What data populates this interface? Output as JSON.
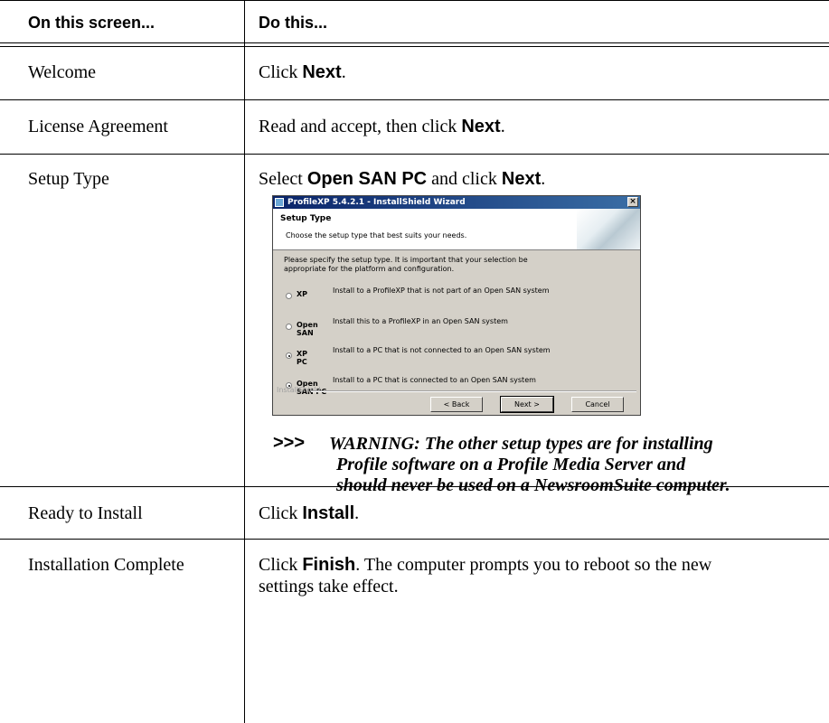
{
  "table": {
    "headers": [
      "On this screen...",
      "Do this..."
    ],
    "rows": [
      {
        "screen": "Welcome",
        "action": {
          "pre": "Click ",
          "bold": "Next",
          "post": "."
        }
      },
      {
        "screen": "License Agreement",
        "action": {
          "pre": "Read and accept, then click ",
          "bold": "Next",
          "post": "."
        }
      },
      {
        "screen": "Setup Type",
        "action": {
          "pre": "Select ",
          "bold": "Open SAN PC",
          "mid": " and click ",
          "bold2": "Next",
          "post": "."
        }
      },
      {
        "screen": "Ready to Install",
        "action": {
          "pre": "Click ",
          "bold": "Install",
          "post": "."
        }
      },
      {
        "screen": "Installation Complete",
        "action": {
          "pre": "Click ",
          "bold": "Finish",
          "post": ". The computer prompts you to reboot so the new",
          "line2": "settings take effect."
        }
      }
    ]
  },
  "dialog": {
    "title": "ProfileXP 5.4.2.1 - InstallShield Wizard",
    "close_glyph": "×",
    "banner_title": "Setup Type",
    "banner_subtitle": "Choose the setup type that best suits your needs.",
    "intro_line1": "Please specify the setup type. It is important that your selection be",
    "intro_line2": "appropriate for the platform and configuration.",
    "options": [
      {
        "label_line1": "XP",
        "label_line2": "",
        "desc": "Install to a ProfileXP that is not part of an Open SAN system",
        "selected": false
      },
      {
        "label_line1": "Open",
        "label_line2": "SAN",
        "desc": "Install this to a ProfileXP in an Open SAN system",
        "selected": false
      },
      {
        "label_line1": "XP",
        "label_line2": "PC",
        "desc": "Install to a PC that is not connected to an Open SAN system",
        "selected": true
      },
      {
        "label_line1": "Open",
        "label_line2": "SAN PC",
        "desc": "Install to a PC that is connected to an Open SAN system",
        "selected": true
      }
    ],
    "brand": "InstallShield",
    "buttons": {
      "back": "< Back",
      "next": "Next >",
      "cancel": "Cancel"
    }
  },
  "warning": {
    "marker": ">>>",
    "line1": "WARNING: The other setup types are for installing",
    "line2": "Profile software on a Profile Media Server and",
    "line3": "should never be used on a NewsroomSuite computer."
  }
}
